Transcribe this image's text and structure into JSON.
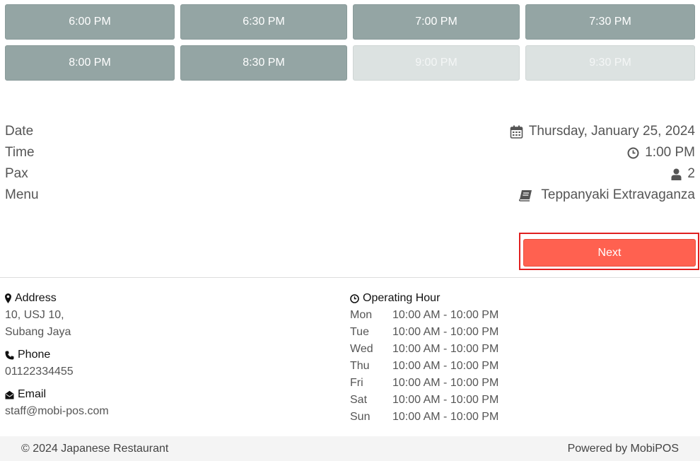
{
  "time_slots": [
    [
      {
        "label": "6:00 PM",
        "enabled": true
      },
      {
        "label": "6:30 PM",
        "enabled": true
      },
      {
        "label": "7:00 PM",
        "enabled": true
      },
      {
        "label": "7:30 PM",
        "enabled": true
      }
    ],
    [
      {
        "label": "8:00 PM",
        "enabled": true
      },
      {
        "label": "8:30 PM",
        "enabled": true
      },
      {
        "label": "9:00 PM",
        "enabled": false
      },
      {
        "label": "9:30 PM",
        "enabled": false
      }
    ]
  ],
  "summary": {
    "date_label": "Date",
    "date_value": "Thursday, January 25, 2024",
    "time_label": "Time",
    "time_value": "1:00 PM",
    "pax_label": "Pax",
    "pax_value": "2",
    "menu_label": "Menu",
    "menu_value": "Teppanyaki Extravaganza"
  },
  "next_button": "Next",
  "contact": {
    "address_heading": "Address",
    "address_lines": [
      "10, USJ 10,",
      "Subang Jaya"
    ],
    "phone_heading": "Phone",
    "phone": "01122334455",
    "email_heading": "Email",
    "email": "staff@mobi-pos.com"
  },
  "hours": {
    "heading": "Operating Hour",
    "rows": [
      {
        "day": "Mon",
        "hours": "10:00 AM - 10:00 PM"
      },
      {
        "day": "Tue",
        "hours": "10:00 AM - 10:00 PM"
      },
      {
        "day": "Wed",
        "hours": "10:00 AM - 10:00 PM"
      },
      {
        "day": "Thu",
        "hours": "10:00 AM - 10:00 PM"
      },
      {
        "day": "Fri",
        "hours": "10:00 AM - 10:00 PM"
      },
      {
        "day": "Sat",
        "hours": "10:00 AM - 10:00 PM"
      },
      {
        "day": "Sun",
        "hours": "10:00 AM - 10:00 PM"
      }
    ]
  },
  "footer": {
    "copyright": "© 2024 Japanese Restaurant",
    "powered": "Powered by MobiPOS"
  },
  "colors": {
    "slot_active": "#94a5a4",
    "slot_disabled": "#dce2e1",
    "next_button": "#ff6150",
    "highlight_border": "#e02020"
  }
}
